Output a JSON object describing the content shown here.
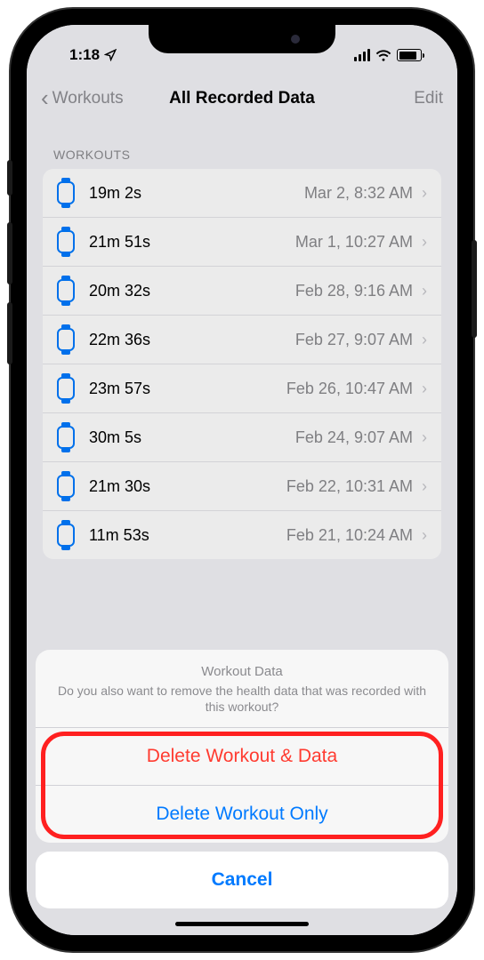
{
  "status": {
    "time": "1:18",
    "location_icon": "◤"
  },
  "nav": {
    "back_label": "Workouts",
    "title": "All Recorded Data",
    "edit_label": "Edit"
  },
  "section_header": "WORKOUTS",
  "workouts": [
    {
      "duration": "19m 2s",
      "date": "Mar 2, 8:32 AM"
    },
    {
      "duration": "21m 51s",
      "date": "Mar 1, 10:27 AM"
    },
    {
      "duration": "20m 32s",
      "date": "Feb 28, 9:16 AM"
    },
    {
      "duration": "22m 36s",
      "date": "Feb 27, 9:07 AM"
    },
    {
      "duration": "23m 57s",
      "date": "Feb 26, 10:47 AM"
    },
    {
      "duration": "30m 5s",
      "date": "Feb 24, 9:07 AM"
    },
    {
      "duration": "21m 30s",
      "date": "Feb 22, 10:31 AM"
    },
    {
      "duration": "11m 53s",
      "date": "Feb 21, 10:24 AM"
    }
  ],
  "sheet": {
    "title": "Workout Data",
    "message": "Do you also want to remove the health data that was recorded with this workout?",
    "delete_data": "Delete Workout & Data",
    "delete_only": "Delete Workout Only",
    "cancel": "Cancel"
  }
}
